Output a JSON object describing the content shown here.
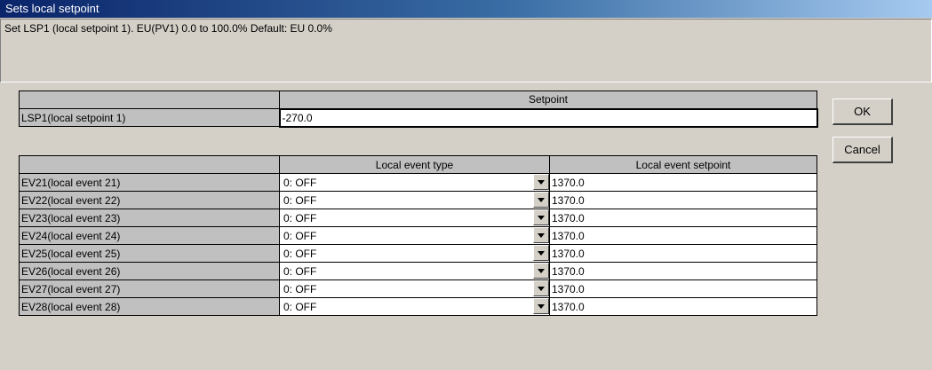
{
  "window": {
    "title": "Sets local setpoint"
  },
  "description": "Set LSP1 (local setpoint 1).  EU(PV1) 0.0 to 100.0%  Default: EU 0.0%",
  "setpoint_table": {
    "header": "Setpoint",
    "row_label": "LSP1(local setpoint 1)",
    "value": "-270.0"
  },
  "event_table": {
    "headers": [
      "Local event type",
      "Local event setpoint"
    ],
    "rows": [
      {
        "label": "EV21(local event 21)",
        "type": "0: OFF",
        "setpoint": "1370.0"
      },
      {
        "label": "EV22(local event 22)",
        "type": "0: OFF",
        "setpoint": "1370.0"
      },
      {
        "label": "EV23(local event 23)",
        "type": "0: OFF",
        "setpoint": "1370.0"
      },
      {
        "label": "EV24(local event 24)",
        "type": "0: OFF",
        "setpoint": "1370.0"
      },
      {
        "label": "EV25(local event 25)",
        "type": "0: OFF",
        "setpoint": "1370.0"
      },
      {
        "label": "EV26(local event 26)",
        "type": "0: OFF",
        "setpoint": "1370.0"
      },
      {
        "label": "EV27(local event 27)",
        "type": "0: OFF",
        "setpoint": "1370.0"
      },
      {
        "label": "EV28(local event 28)",
        "type": "0: OFF",
        "setpoint": "1370.0"
      }
    ]
  },
  "buttons": {
    "ok": "OK",
    "cancel": "Cancel"
  },
  "icons": {
    "dropdown": "chevron-down-icon"
  }
}
